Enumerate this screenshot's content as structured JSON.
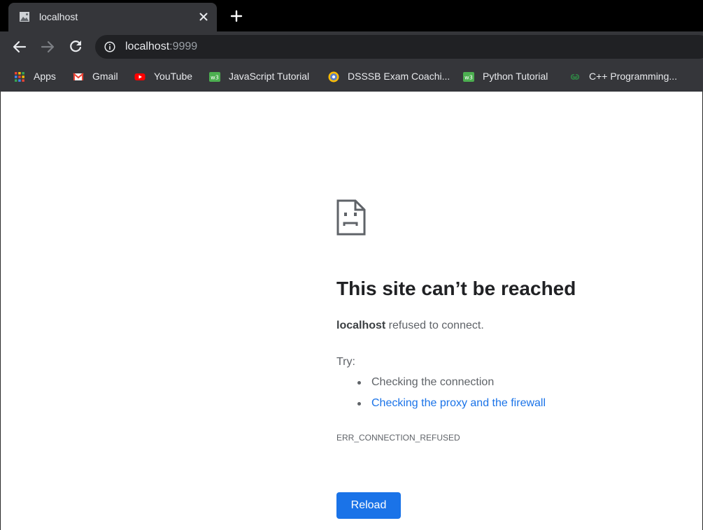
{
  "browser": {
    "tab": {
      "title": "localhost",
      "favicon": "generic-page-icon",
      "close_icon": "close-icon"
    },
    "newtab_icon": "plus-icon",
    "toolbar": {
      "back_icon": "arrow-left-icon",
      "forward_icon": "arrow-right-icon",
      "reload_icon": "reload-icon",
      "url_host": "localhost",
      "url_port": ":9999",
      "site_info_icon": "info-icon"
    },
    "bookmarks": [
      {
        "label": "Apps",
        "icon": "apps-grid-icon"
      },
      {
        "label": "Gmail",
        "icon": "gmail-icon"
      },
      {
        "label": "YouTube",
        "icon": "youtube-icon"
      },
      {
        "label": "JavaScript Tutorial",
        "icon": "w3schools-icon"
      },
      {
        "label": "DSSSB Exam Coachi...",
        "icon": "coaching-logo-icon"
      },
      {
        "label": "Python Tutorial",
        "icon": "w3schools-icon"
      },
      {
        "label": "C++ Programming...",
        "icon": "geeksforgeeks-icon"
      }
    ]
  },
  "error_page": {
    "icon": "sad-document-icon",
    "headline": "This site can’t be reached",
    "host": "localhost",
    "message": " refused to connect.",
    "try_label": "Try:",
    "suggestions": [
      "Checking the connection",
      "Checking the proxy and the firewall"
    ],
    "error_code": "ERR_CONNECTION_REFUSED",
    "reload_label": "Reload"
  },
  "colors": {
    "accent": "#1a73e8",
    "tab_strip": "#000000",
    "toolbar": "#35363a",
    "omnibox": "#202124"
  }
}
